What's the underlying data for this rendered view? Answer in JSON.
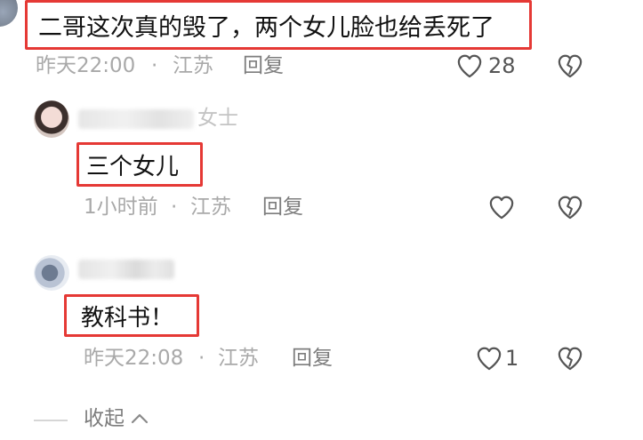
{
  "comments": [
    {
      "text": "二哥这次真的毁了，两个女儿脸也给丢死了",
      "time": "昨天22:00",
      "separator": "·",
      "location": "江苏",
      "reply_label": "回复",
      "like_count": "28"
    },
    {
      "username_suffix": "女士",
      "text": "三个女儿",
      "time": "1小时前",
      "separator": "·",
      "location": "江苏",
      "reply_label": "回复",
      "like_count": ""
    },
    {
      "text": "教科书！",
      "time": "昨天22:08",
      "separator": "·",
      "location": "江苏",
      "reply_label": "回复",
      "like_count": "1"
    }
  ],
  "collapse": {
    "label": "收起"
  },
  "colors": {
    "highlight": "#e53935",
    "meta": "#a9a9a9",
    "icon": "#555555"
  },
  "icons": [
    "heart-icon",
    "dislike-heart-icon",
    "chevron-up-icon"
  ]
}
